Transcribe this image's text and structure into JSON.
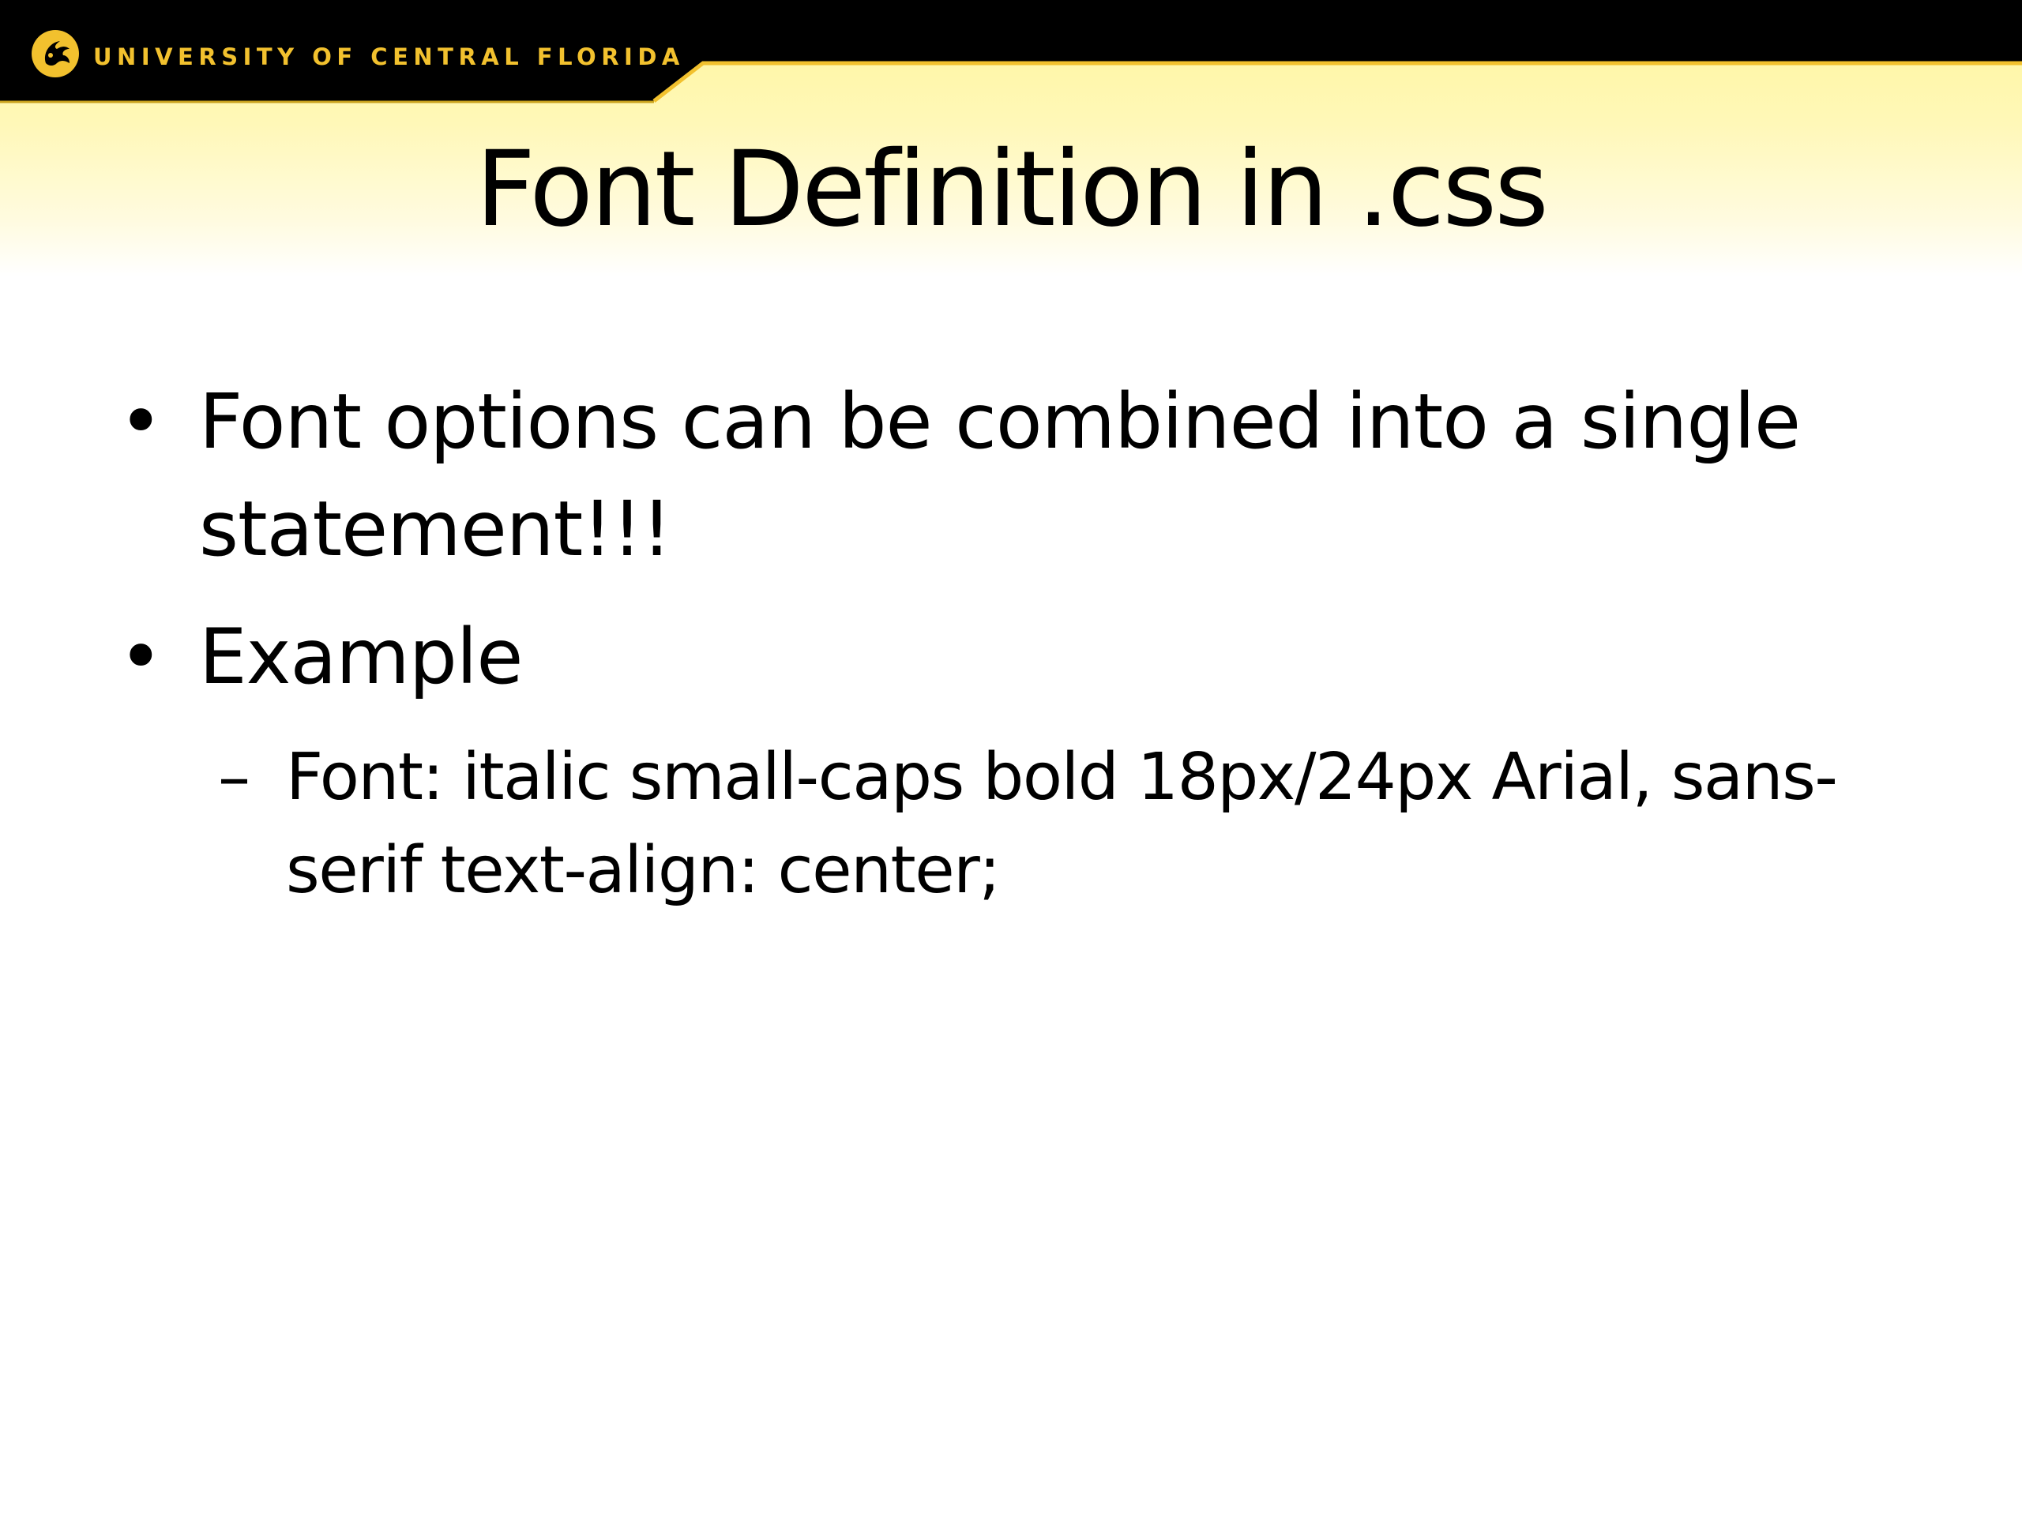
{
  "header": {
    "university_name": "UNIVERSITY OF CENTRAL FLORIDA",
    "logo_icon": "pegasus-logo-icon",
    "bar_color": "#000000",
    "accent_color": "#f2c12e"
  },
  "slide": {
    "title": "Font Definition in .css",
    "bullets": [
      {
        "marker": "•",
        "lines": [
          "Font options can be combined into a single",
          "statement!!!"
        ]
      },
      {
        "marker": "•",
        "lines": [
          "Example"
        ],
        "sub_items": [
          {
            "marker": "–",
            "lines": [
              "Font: italic small-caps bold 18px/24px Arial, sans-",
              "serif text-align: center;"
            ]
          }
        ]
      }
    ]
  }
}
